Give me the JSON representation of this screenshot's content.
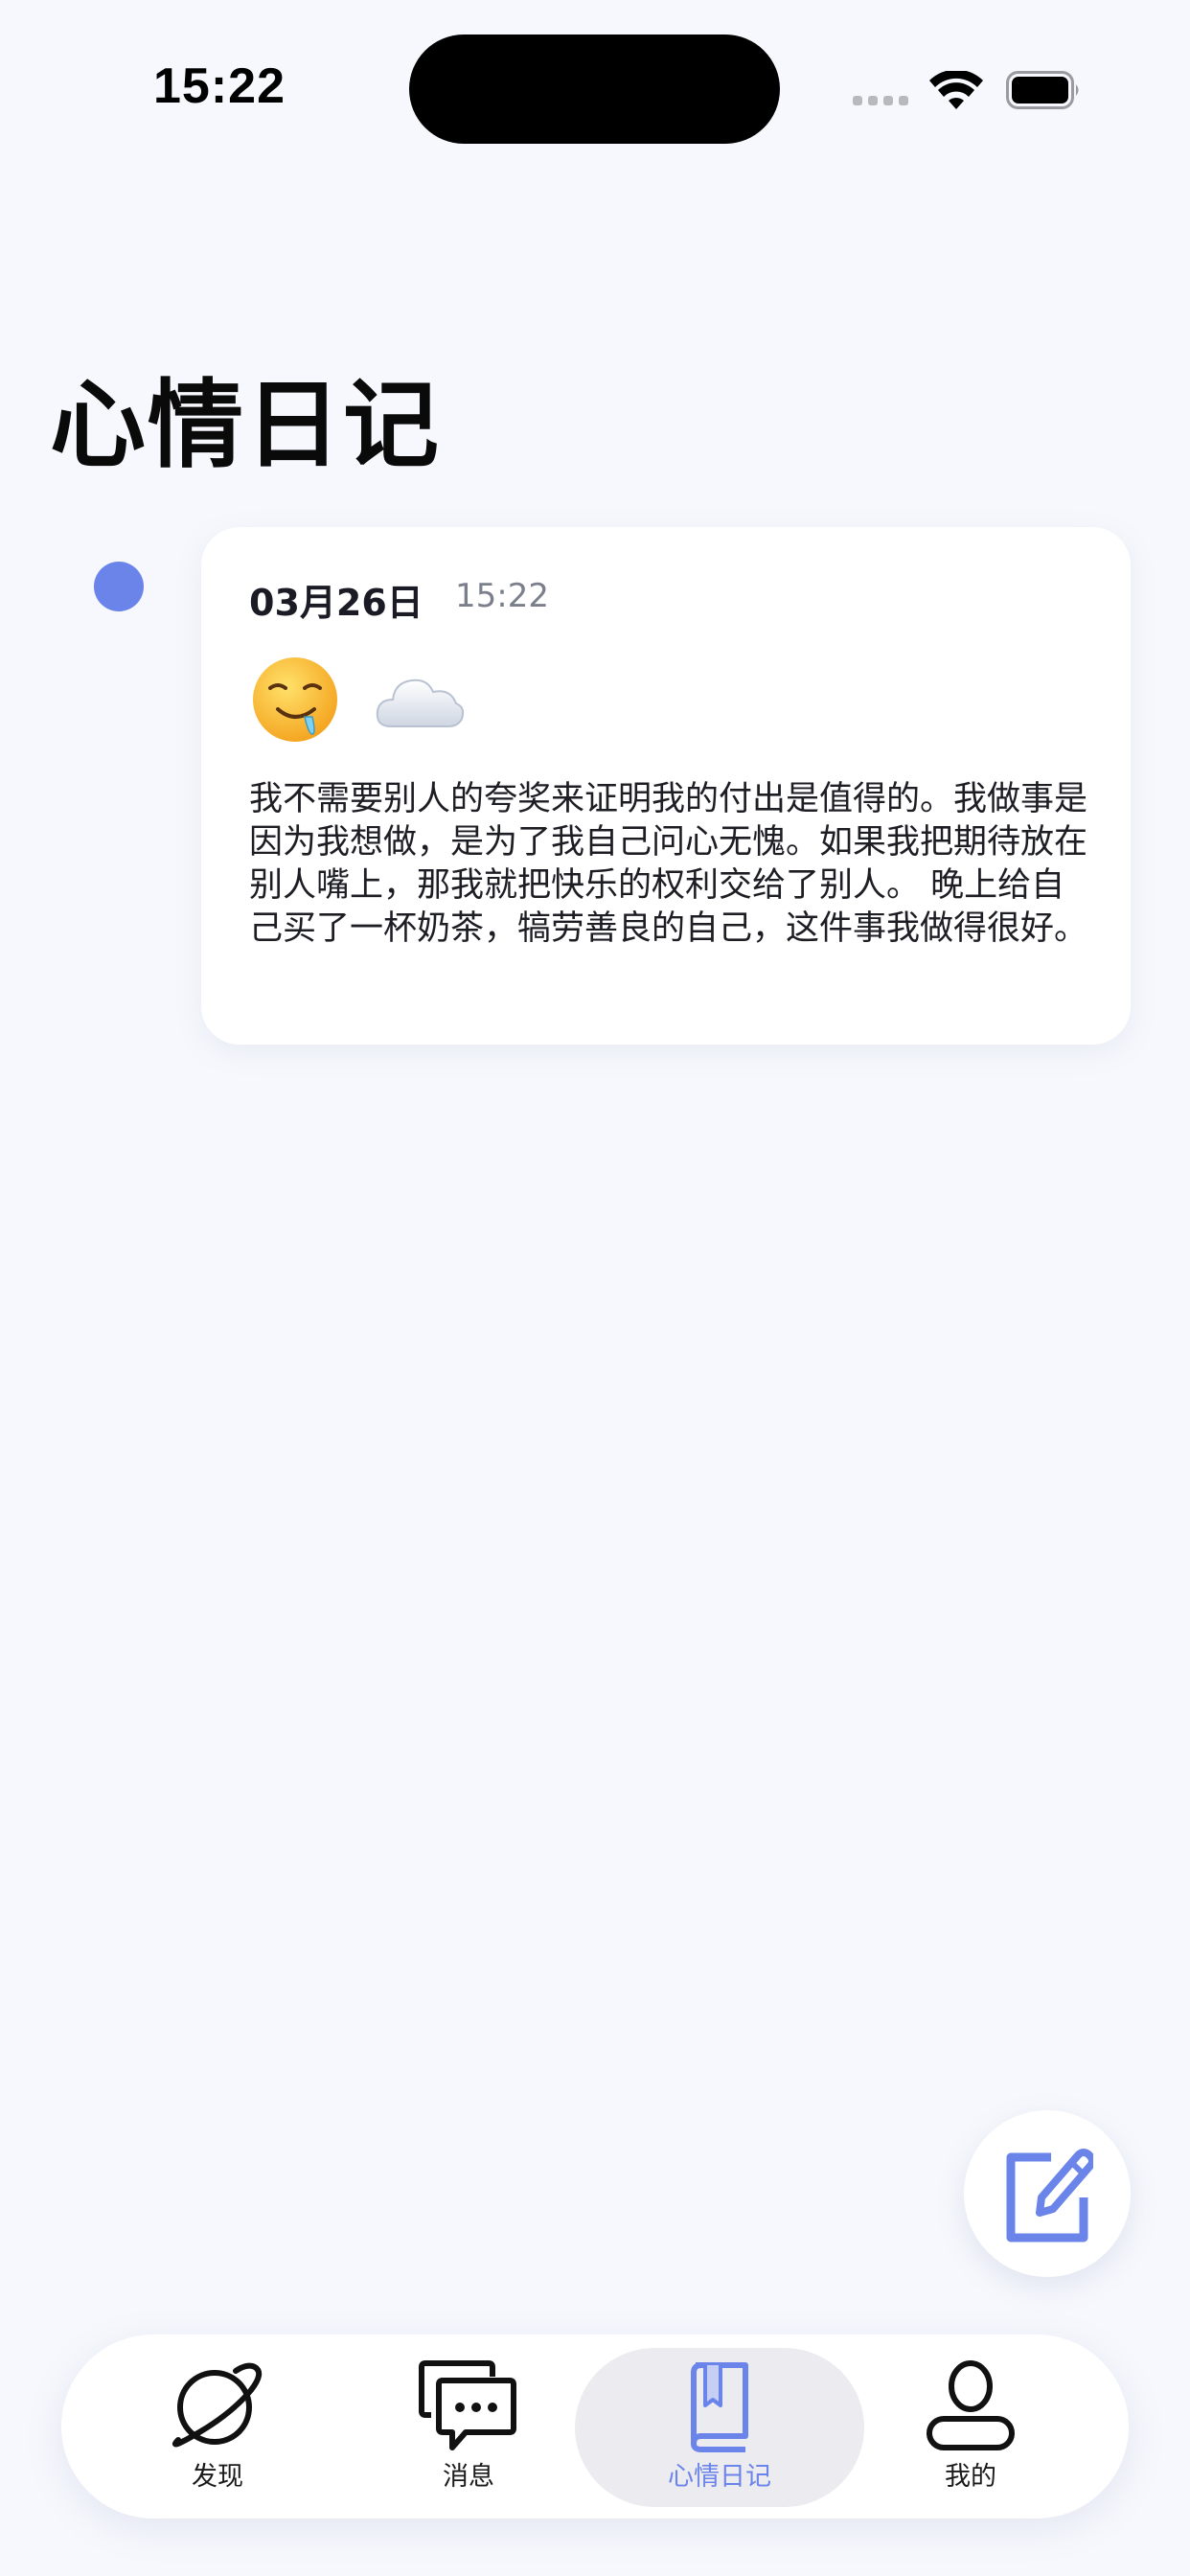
{
  "status_bar": {
    "time": "15:22"
  },
  "page": {
    "title": "心情日记"
  },
  "entry": {
    "date": "03月26日",
    "time": "15:22",
    "mood_icon": "drooling-face-emoji",
    "weather_icon": "cloud-emoji",
    "text": "我不需要别人的夸奖来证明我的付出是值得的。我做事是因为我想做，是为了我自己问心无愧。如果我把期待放在别人嘴上，那我就把快乐的权利交给了别人。 晚上给自己买了一杯奶茶，犒劳善良的自己，这件事我做得很好。"
  },
  "fab": {
    "icon": "edit-icon"
  },
  "tab_bar": {
    "tabs": [
      {
        "label": "发现",
        "icon": "planet-icon",
        "active": false
      },
      {
        "label": "消息",
        "icon": "chat-bubbles-icon",
        "active": false
      },
      {
        "label": "心情日记",
        "icon": "book-icon",
        "active": true
      },
      {
        "label": "我的",
        "icon": "person-icon",
        "active": false
      }
    ]
  },
  "colors": {
    "accent": "#6b84ea",
    "background": "#f6f8fd",
    "card": "#ffffff"
  }
}
